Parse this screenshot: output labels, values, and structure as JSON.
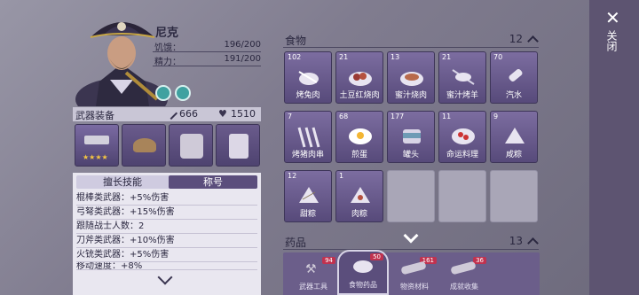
{
  "character": {
    "name": "尼克",
    "hunger_label": "饥饿：",
    "hunger_value": "196/200",
    "energy_label": "精力：",
    "energy_value": "191/200"
  },
  "weapons": {
    "title": "武器装备",
    "attack": "666",
    "health": "1510"
  },
  "skills": {
    "tab_skills": "擅长技能",
    "tab_title": "称号",
    "lines": [
      "棍棒类武器：+5%伤害",
      "弓弩类武器：+15%伤害",
      "跟随战士人数：2",
      "刀斧类武器：+10%伤害",
      "火铳类武器：+5%伤害",
      "移动速度：+8%"
    ]
  },
  "inventory": {
    "food_section": "食物",
    "food_count": "12",
    "medicine_section": "药品",
    "medicine_count": "13",
    "items": [
      {
        "qty": "102",
        "name": "烤兔肉"
      },
      {
        "qty": "21",
        "name": "土豆红烧肉"
      },
      {
        "qty": "13",
        "name": "蜜汁烧肉"
      },
      {
        "qty": "21",
        "name": "蜜汁烤羊"
      },
      {
        "qty": "70",
        "name": "汽水"
      },
      {
        "qty": "7",
        "name": "烤猪肉串"
      },
      {
        "qty": "68",
        "name": "煎蛋"
      },
      {
        "qty": "177",
        "name": "罐头"
      },
      {
        "qty": "11",
        "name": "命运料理"
      },
      {
        "qty": "9",
        "name": "咸粽"
      },
      {
        "qty": "12",
        "name": "甜粽"
      },
      {
        "qty": "1",
        "name": "肉粽"
      }
    ]
  },
  "bottom_tabs": [
    {
      "label": "武器工具",
      "badge": "94"
    },
    {
      "label": "食物药品",
      "badge": "50"
    },
    {
      "label": "物资材料",
      "badge": "161"
    },
    {
      "label": "成就收集",
      "badge": "36"
    }
  ],
  "close_label": "关闭",
  "colors": {
    "panel": "#5b4e7c",
    "badge": "#c0324f"
  }
}
